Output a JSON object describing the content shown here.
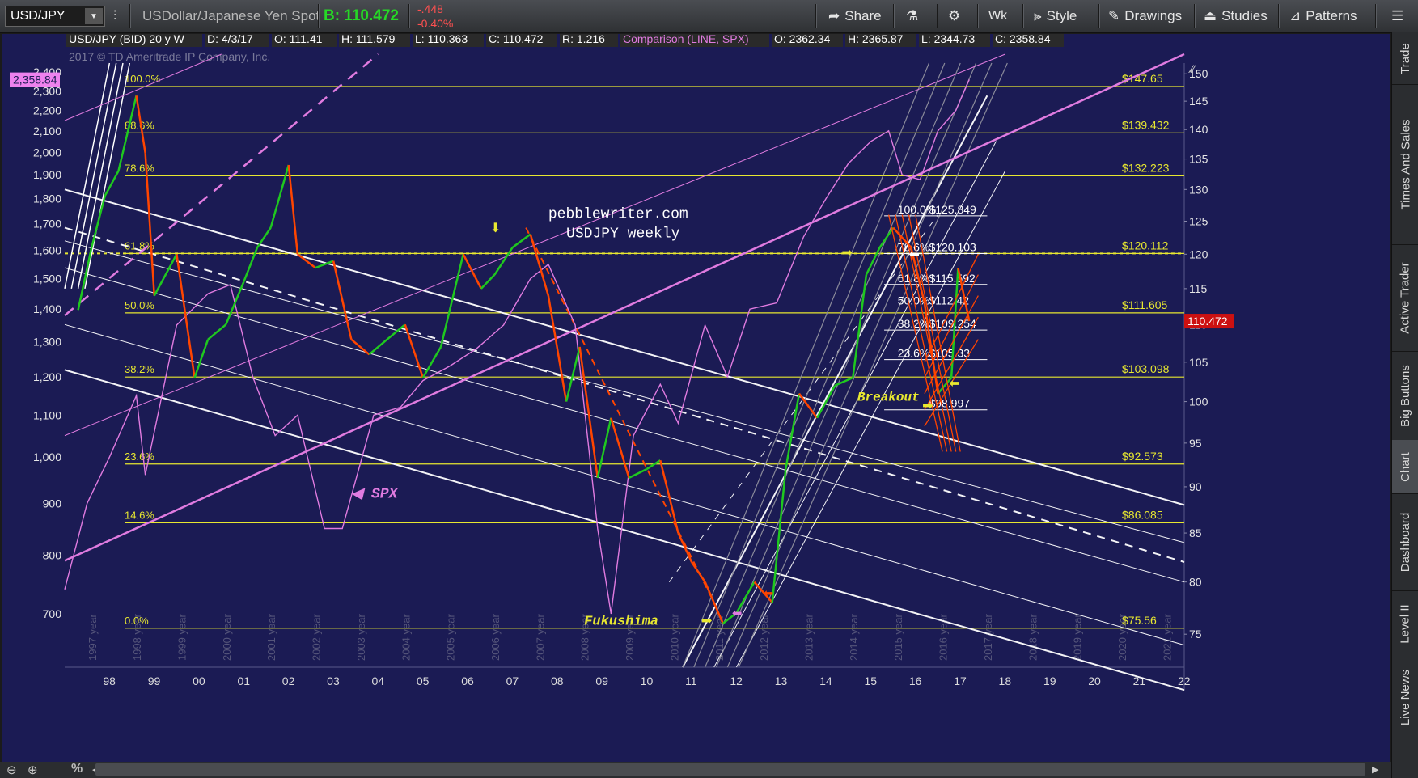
{
  "toolbar": {
    "symbol": "USD/JPY",
    "description": "USDollar/Japanese Yen Spot",
    "bid_label": "B: 110.472",
    "change": "-.448",
    "change_pct": "-0.40%",
    "buttons": {
      "share": "Share",
      "period": "Wk",
      "style": "Style",
      "drawings": "Drawings",
      "studies": "Studies",
      "patterns": "Patterns"
    }
  },
  "chart_header": {
    "title": "USD/JPY (BID) 20 y W",
    "date": "D: 4/3/17",
    "open": "O: 111.41",
    "high": "H: 111.57",
    "high_sub": "9",
    "low": "L: 110.36",
    "low_sub": "3",
    "close": "C: 110.47",
    "close_sub": "2",
    "range": "R: 1.21",
    "range_sub": "6",
    "comparison": "Comparison (LINE, SPX)",
    "cmp_open": "O: 2362.34",
    "cmp_high": "H: 2365.87",
    "cmp_low": "L: 2344.73",
    "cmp_close": "C: 2358.84"
  },
  "watermark": "2017 © TD Ameritrade IP Company, Inc.",
  "annotations": {
    "site": "pebblewriter.com",
    "subtitle": "USDJPY weekly",
    "spx_label": "SPX",
    "fukushima": "Fukushima",
    "breakout": "Breakout"
  },
  "price_badges": {
    "spx_current": "2,358.84",
    "usdjpy_current": "110.47",
    "usdjpy_current_sub": "2"
  },
  "colors": {
    "background": "#1b1b54",
    "fib_yellow": "#e8e830",
    "spx_line": "#e07be0",
    "channel_white": "#ffffff",
    "down_candle": "#ff4500",
    "up_candle": "#1fc81f"
  },
  "chart_data": {
    "type": "line",
    "x_axis_labels": [
      "98",
      "99",
      "00",
      "01",
      "02",
      "03",
      "04",
      "05",
      "06",
      "07",
      "08",
      "09",
      "10",
      "11",
      "12",
      "13",
      "14",
      "15",
      "16",
      "17",
      "18",
      "19",
      "20",
      "21",
      "22"
    ],
    "year_labels": [
      "1997 year",
      "1998 year",
      "1999 year",
      "2000 year",
      "2001 year",
      "2002 year",
      "2003 year",
      "2004 year",
      "2005 year",
      "2006 year",
      "2007 year",
      "2008 year",
      "2009 year",
      "2010 year",
      "2011 year",
      "2012 year",
      "2013 year",
      "2014 year",
      "2015 year",
      "2016 year",
      "2017 year",
      "2018 year",
      "2019 year",
      "2020 year",
      "2021 year"
    ],
    "right_axis_ticks": [
      75,
      80,
      85,
      90,
      95,
      100,
      105,
      110,
      115,
      120,
      125,
      130,
      135,
      140,
      145,
      150
    ],
    "left_axis_ticks": [
      "700",
      "800",
      "900",
      "1,000",
      "1,100",
      "1,200",
      "1,300",
      "1,400",
      "1,500",
      "1,600",
      "1,700",
      "1,800",
      "1,900",
      "2,000",
      "2,100",
      "2,200",
      "2,300",
      "2,400"
    ],
    "fib_levels": [
      {
        "pct": "100.0%",
        "price": "$147.65",
        "value": 147.65
      },
      {
        "pct": "88.6%",
        "price": "$139.43",
        "sub": "2",
        "value": 139.43
      },
      {
        "pct": "78.6%",
        "price": "$132.22",
        "sub": "3",
        "value": 132.22
      },
      {
        "pct": "61.8%",
        "price": "$120.11",
        "sub": "2",
        "value": 120.11
      },
      {
        "pct": "50.0%",
        "price": "$111.60",
        "sub": "5",
        "value": 111.6
      },
      {
        "pct": "38.2%",
        "price": "$103.09",
        "sub": "8",
        "value": 103.09
      },
      {
        "pct": "23.6%",
        "price": "$92.57",
        "sub": "3",
        "value": 92.57
      },
      {
        "pct": "14.6%",
        "price": "$86.08",
        "sub": "5",
        "value": 86.08
      },
      {
        "pct": "0.0%",
        "price": "$75.56",
        "value": 75.56
      }
    ],
    "inner_fib_levels": [
      {
        "pct": "100.0%",
        "price": "$125.84",
        "sub": "9",
        "value": 125.84
      },
      {
        "pct": "78.6%",
        "price": "$120.10",
        "sub": "3",
        "value": 120.1
      },
      {
        "pct": "61.8%",
        "price": "$115.59",
        "sub": "2",
        "value": 115.59
      },
      {
        "pct": "50.0%",
        "price": "$112.42",
        "value": 112.42
      },
      {
        "pct": "38.2%",
        "price": "$109.25",
        "sub": "4",
        "value": 109.25
      },
      {
        "pct": "23.6%",
        "price": "$105.33",
        "value": 105.33
      },
      {
        "pct": "",
        "price": "$98.99",
        "sub": "7",
        "value": 98.99
      }
    ],
    "usdjpy_series": {
      "name": "USD/JPY",
      "x": [
        1997.3,
        1997.6,
        1997.9,
        1998.2,
        1998.6,
        1998.8,
        1999.0,
        1999.5,
        1999.9,
        2000.2,
        2000.6,
        2001.0,
        2001.3,
        2001.6,
        2002.0,
        2002.2,
        2002.6,
        2003.0,
        2003.4,
        2003.8,
        2004.2,
        2004.6,
        2005.0,
        2005.4,
        2005.9,
        2006.3,
        2006.6,
        2007.0,
        2007.4,
        2007.8,
        2008.2,
        2008.5,
        2008.9,
        2009.2,
        2009.6,
        2010.0,
        2010.3,
        2010.7,
        2011.0,
        2011.3,
        2011.7,
        2012.0,
        2012.4,
        2012.8,
        2013.1,
        2013.4,
        2013.8,
        2014.2,
        2014.6,
        2014.9,
        2015.2,
        2015.5,
        2015.9,
        2016.2,
        2016.5,
        2016.8,
        2016.95,
        2017.2
      ],
      "y": [
        112,
        121,
        129,
        133,
        146,
        136,
        114,
        120,
        103,
        108,
        110,
        116,
        121,
        124,
        134,
        120,
        118,
        119,
        108,
        106,
        108,
        110,
        103,
        107,
        120,
        115,
        117,
        121,
        123,
        114,
        100,
        107,
        91,
        98,
        91,
        92,
        93,
        85,
        82,
        80,
        76,
        77,
        80,
        78,
        92,
        101,
        98,
        102,
        103,
        117,
        121,
        124,
        121,
        113,
        101,
        103,
        118,
        110.47
      ]
    },
    "spx_series": {
      "name": "SPX",
      "x": [
        1997.0,
        1997.5,
        1998.0,
        1998.6,
        1998.8,
        1999.5,
        2000.2,
        2000.7,
        2001.2,
        2001.7,
        2002.2,
        2002.8,
        2003.2,
        2003.9,
        2004.5,
        2005.0,
        2005.6,
        2006.2,
        2006.8,
        2007.4,
        2007.8,
        2008.4,
        2008.9,
        2009.2,
        2009.7,
        2010.3,
        2010.7,
        2011.3,
        2011.8,
        2012.3,
        2012.9,
        2013.5,
        2014.0,
        2014.5,
        2015.0,
        2015.4,
        2015.7,
        2016.1,
        2016.5,
        2016.9,
        2017.2
      ],
      "y": [
        740,
        900,
        1000,
        1150,
        960,
        1350,
        1450,
        1480,
        1200,
        1050,
        1100,
        850,
        850,
        1100,
        1120,
        1190,
        1230,
        1280,
        1350,
        1500,
        1550,
        1350,
        850,
        700,
        1050,
        1180,
        1080,
        1350,
        1200,
        1400,
        1420,
        1650,
        1800,
        1950,
        2050,
        2100,
        1900,
        1880,
        2100,
        2200,
        2360
      ]
    },
    "right_ylim": [
      72,
      152
    ],
    "left_ylim": [
      620,
      2450
    ],
    "xlim": [
      1997.0,
      2022.0
    ]
  }
}
